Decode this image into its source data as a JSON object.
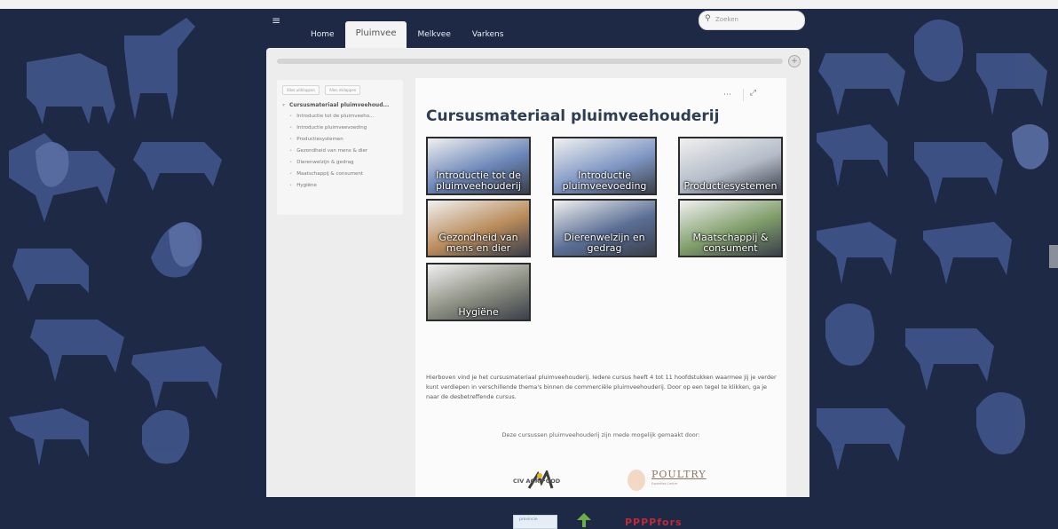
{
  "nav": {
    "menu_icon": "hamburger-icon",
    "tabs": [
      {
        "label": "Home",
        "active": false
      },
      {
        "label": "Pluimvee",
        "active": true
      },
      {
        "label": "Melkvee",
        "active": false
      },
      {
        "label": "Varkens",
        "active": false
      }
    ],
    "search": {
      "placeholder": "Zoeken",
      "icon": "search-icon"
    }
  },
  "toolbar": {
    "add_icon": "plus-circle-icon"
  },
  "sidebar": {
    "buttons": [
      "Alles uitklappen",
      "Alles inklappen"
    ],
    "items": [
      {
        "label": "Cursusmateriaal pluimveehoud...",
        "level": 0
      },
      {
        "label": "Introductie tot de pluimveeho...",
        "level": 1
      },
      {
        "label": "Introductie pluimveevoeding",
        "level": 1
      },
      {
        "label": "Productiesystemen",
        "level": 1
      },
      {
        "label": "Gezondheid van mens & dier",
        "level": 1
      },
      {
        "label": "Dierenwelzijn & gedrag",
        "level": 1
      },
      {
        "label": "Maatschappij & consument",
        "level": 1
      },
      {
        "label": "Hygiëne",
        "level": 1
      }
    ]
  },
  "content": {
    "title": "Cursusmateriaal pluimveehouderij",
    "more_icon": "more-dots-icon",
    "expand_icon": "expand-icon",
    "tiles": [
      {
        "label": "Introductie tot de pluimveehouderij",
        "color": "#6b86b8"
      },
      {
        "label": "Introductie pluimveevoeding",
        "color": "#7f97c4"
      },
      {
        "label": "Productiesystemen",
        "color": "#b4bcc8"
      },
      {
        "label": "Gezondheid van mens en dier",
        "color": "#b98b5a"
      },
      {
        "label": "Dierenwelzijn en gedrag",
        "color": "#5a6e94"
      },
      {
        "label": "Maatschappij & consument",
        "color": "#7f9d6a"
      },
      {
        "label": "Hygiëne",
        "color": "#8a8d80"
      }
    ],
    "description": "Hierboven vind je het cursusmateriaal pluimveehouderij. Iedere cursus heeft 4 tot 11 hoofdstukken waarmee jij je verder kunt verdiepen in verschillende thema's binnen de commerciële pluimveehouderij. Door op een tegel te klikken, ga je naar de desbetreffende cursus.",
    "sponsor_text": "Deze cursussen pluimveehouderij zijn mede mogelijk gemaakt door:",
    "logos": {
      "civ": "CIV AGRIFOOD",
      "poultry": "POULTRY",
      "poultry_sub": "Expertise Centre",
      "provincie": "provincie",
      "red": "PPPPfors"
    }
  }
}
